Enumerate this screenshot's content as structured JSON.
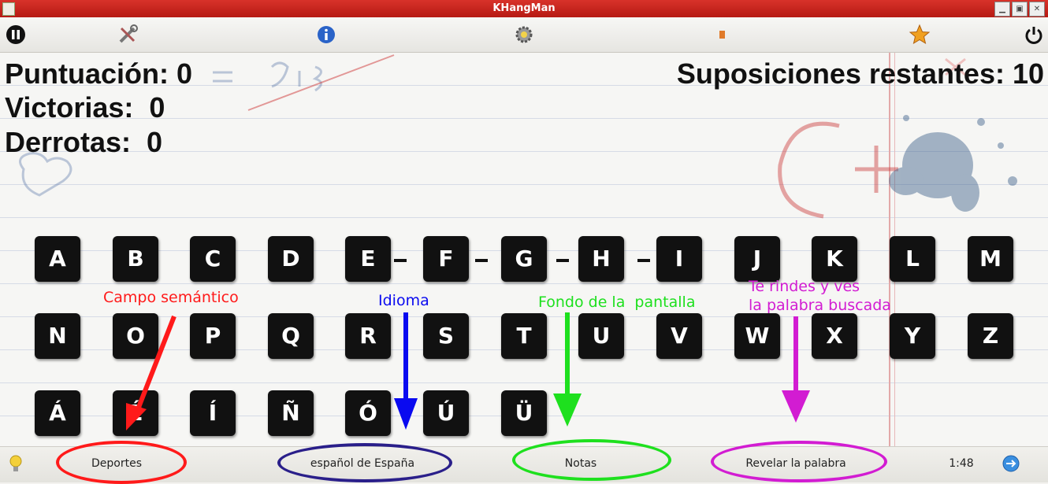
{
  "window": {
    "title": "KHangMan"
  },
  "toolbar": {
    "icons": [
      "pause-icon",
      "tools-icon",
      "info-icon",
      "settings-gear-icon",
      "bookmark-icon",
      "star-icon",
      "power-icon"
    ]
  },
  "scores": {
    "score_label": "Puntuación: 0",
    "wins_label": "Victorias:  0",
    "losses_label": "Derrotas:  0",
    "guesses_label": "Suposiciones restantes: 10"
  },
  "keyboard": {
    "row1": [
      "A",
      "B",
      "C",
      "D",
      "E",
      "F",
      "G",
      "H",
      "I",
      "J",
      "K",
      "L",
      "M"
    ],
    "row2": [
      "N",
      "O",
      "P",
      "Q",
      "R",
      "S",
      "T",
      "U",
      "V",
      "W",
      "X",
      "Y",
      "Z"
    ],
    "row3": [
      "Á",
      "É",
      "Í",
      "Ñ",
      "Ó",
      "Ú",
      "Ü"
    ]
  },
  "annotations": {
    "category": "Campo semántico",
    "language": "Idioma",
    "background": "Fondo de la  pantalla",
    "reveal_line1": "Te rindes y ves",
    "reveal_line2": "la palabra buscada"
  },
  "statusbar": {
    "category": "Deportes",
    "language": "español de España",
    "theme": "Notas",
    "reveal": "Revelar la palabra",
    "timer": "1:48"
  },
  "colors": {
    "category": "#ff1a1a",
    "language": "#0a0af0",
    "background": "#1ee01e",
    "reveal": "#d21cd2",
    "language_ellipse": "#2a1f8a"
  }
}
